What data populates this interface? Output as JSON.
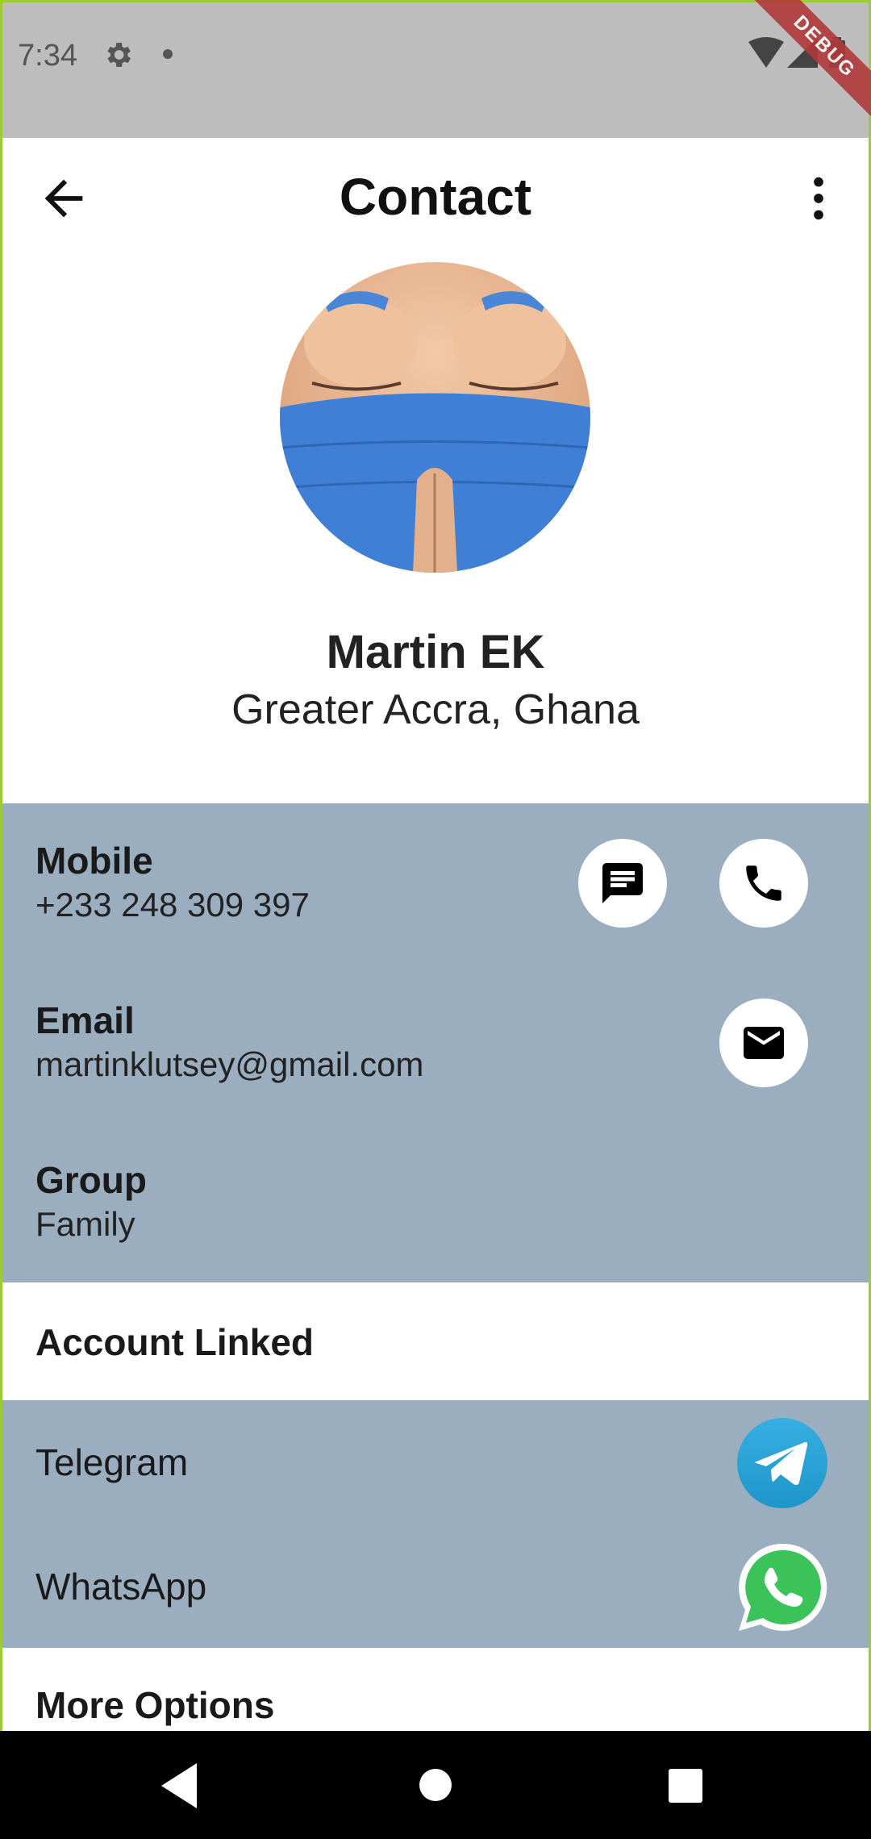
{
  "status_bar": {
    "time": "7:34",
    "debug_label": "DEBUG"
  },
  "app_bar": {
    "title": "Contact"
  },
  "profile": {
    "name": "Martin EK",
    "location": "Greater Accra, Ghana"
  },
  "details": {
    "mobile": {
      "label": "Mobile",
      "value": "+233 248 309 397"
    },
    "email": {
      "label": "Email",
      "value": "martinklutsey@gmail.com"
    },
    "group": {
      "label": "Group",
      "value": "Family"
    }
  },
  "accounts": {
    "title": "Account Linked",
    "items": [
      {
        "label": "Telegram",
        "icon": "telegram-icon"
      },
      {
        "label": "WhatsApp",
        "icon": "whatsapp-icon"
      }
    ]
  },
  "more_options": {
    "title": "More Options"
  },
  "colors": {
    "panel": "#9aaec0",
    "status_bar": "#bdbdbd",
    "telegram": "#2aa3e6",
    "whatsapp": "#3bc35a",
    "debug": "#b13a3a"
  }
}
